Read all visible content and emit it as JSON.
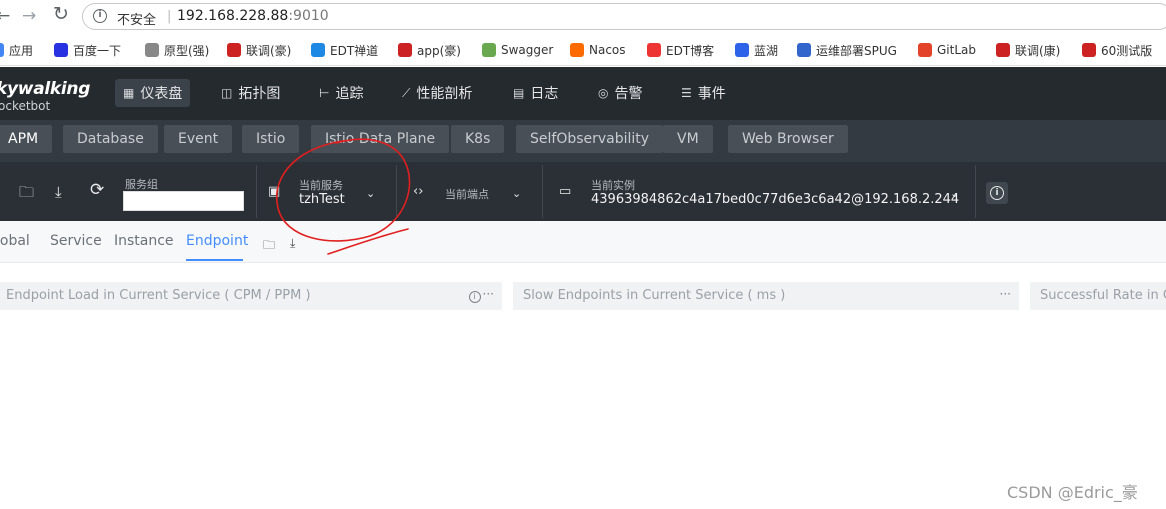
{
  "browser": {
    "insecure_label": "不安全",
    "separator": "|",
    "url_host": "192.168.228.88",
    "url_port": ":9010"
  },
  "bookmarks": [
    {
      "label": "应用",
      "icon": "apps-grid-icon",
      "color": "#4285f4"
    },
    {
      "label": "百度一下",
      "icon": "baidu-paw-icon",
      "color": "#2932e1"
    },
    {
      "label": "原型(强)",
      "icon": "page-icon",
      "color": "#888888"
    },
    {
      "label": "联调(豪)",
      "icon": "yapi-eye-icon",
      "color": "#cc2222"
    },
    {
      "label": "EDT禅道",
      "icon": "zentao-icon",
      "color": "#1e88e5"
    },
    {
      "label": "app(豪)",
      "icon": "yapi-eye-icon",
      "color": "#cc2222"
    },
    {
      "label": "Swagger",
      "icon": "swagger-icon",
      "color": "#6aa84f"
    },
    {
      "label": "Nacos",
      "icon": "nacos-icon",
      "color": "#ff6a00"
    },
    {
      "label": "EDT博客",
      "icon": "blog-c-icon",
      "color": "#ee3333"
    },
    {
      "label": "蓝湖",
      "icon": "lanhu-icon",
      "color": "#2c63e8"
    },
    {
      "label": "运维部署SPUG",
      "icon": "spug-icon",
      "color": "#3366cc"
    },
    {
      "label": "GitLab",
      "icon": "gitlab-fox-icon",
      "color": "#e24329"
    },
    {
      "label": "联调(康)",
      "icon": "yapi-eye-icon",
      "color": "#cc2222"
    },
    {
      "label": "60测试版",
      "icon": "yapi-eye-icon",
      "color": "#cc2222"
    }
  ],
  "header": {
    "logo_main": "kywalking",
    "logo_sub": "ocketbot",
    "nav": [
      {
        "label": "仪表盘",
        "icon": "dashboard-icon",
        "glyph": "▦",
        "active": true
      },
      {
        "label": "拓扑图",
        "icon": "topology-icon",
        "glyph": "◫",
        "active": false
      },
      {
        "label": "追踪",
        "icon": "trace-icon",
        "glyph": "⊢",
        "active": false
      },
      {
        "label": "性能剖析",
        "icon": "profile-icon",
        "glyph": "⟋",
        "active": false
      },
      {
        "label": "日志",
        "icon": "log-icon",
        "glyph": "▤",
        "active": false
      },
      {
        "label": "告警",
        "icon": "alarm-icon",
        "glyph": "◎",
        "active": false
      },
      {
        "label": "事件",
        "icon": "event-icon",
        "glyph": "☰",
        "active": false
      }
    ]
  },
  "layer_tabs": [
    {
      "label": "APM",
      "active": true
    },
    {
      "label": "Database",
      "active": false
    },
    {
      "label": "Event",
      "active": false
    },
    {
      "label": "Istio",
      "active": false
    },
    {
      "label": "Istio Data Plane",
      "active": false
    },
    {
      "label": "K8s",
      "active": false
    },
    {
      "label": "SelfObservability",
      "active": false
    },
    {
      "label": "VM",
      "active": false
    },
    {
      "label": "Web Browser",
      "active": false
    }
  ],
  "toolbar": {
    "group_label": "服务组",
    "service_label": "当前服务",
    "service_value": "tzhTest",
    "endpoint_label": "当前端点",
    "endpoint_value": "",
    "instance_label": "当前实例",
    "instance_value": "43963984862c4a17bed0c77d6e3c6a42@192.168.2.244"
  },
  "dashboard_tabs": [
    {
      "label": "lobal",
      "active": false
    },
    {
      "label": "Service",
      "active": false
    },
    {
      "label": "Instance",
      "active": false
    },
    {
      "label": "Endpoint",
      "active": true
    }
  ],
  "widgets": [
    {
      "title": "Endpoint Load in Current Service ( CPM / PPM )",
      "has_info": true,
      "menu": "···"
    },
    {
      "title": "Slow Endpoints in Current Service ( ms )",
      "has_info": false,
      "menu": "···"
    },
    {
      "title": "Successful Rate in Cu",
      "has_info": false,
      "menu": ""
    }
  ],
  "watermark": "CSDN @Edric_豪",
  "colors": {
    "header_bg": "#252a2f",
    "active_tab": "#448dfe",
    "annotation_red": "#e0201f"
  }
}
